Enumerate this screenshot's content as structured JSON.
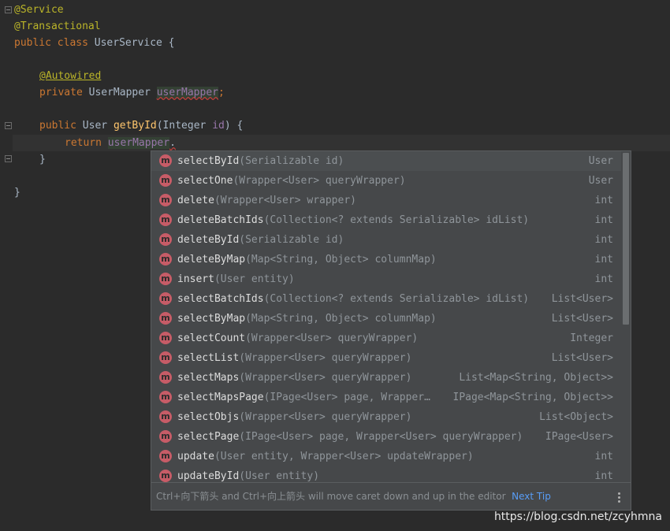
{
  "code": {
    "l1": "@Service",
    "l2": "@Transactional",
    "l3_kw1": "public ",
    "l3_kw2": "class ",
    "l3_name": "UserService {",
    "l5_ann": "@Autowired",
    "l6_kw": "private ",
    "l6_type": "UserMapper ",
    "l6_field": "userMapper",
    "l6_semi": ";",
    "l8_kw": "public ",
    "l8_type": "User ",
    "l8_method": "getById",
    "l8_paren": "(Integer ",
    "l8_param": "id",
    "l8_end": ") {",
    "l9_kw": "return ",
    "l9_field": "userMapper",
    "l9_dot": ".",
    "l10": "}",
    "l12": "}"
  },
  "completion": {
    "items": [
      {
        "name": "selectById",
        "sig": "(Serializable id)",
        "type": "User"
      },
      {
        "name": "selectOne",
        "sig": "(Wrapper<User> queryWrapper)",
        "type": "User"
      },
      {
        "name": "delete",
        "sig": "(Wrapper<User> wrapper)",
        "type": "int"
      },
      {
        "name": "deleteBatchIds",
        "sig": "(Collection<? extends Serializable> idList)",
        "type": "int"
      },
      {
        "name": "deleteById",
        "sig": "(Serializable id)",
        "type": "int"
      },
      {
        "name": "deleteByMap",
        "sig": "(Map<String, Object> columnMap)",
        "type": "int"
      },
      {
        "name": "insert",
        "sig": "(User entity)",
        "type": "int"
      },
      {
        "name": "selectBatchIds",
        "sig": "(Collection<? extends Serializable> idList)",
        "type": "List<User>"
      },
      {
        "name": "selectByMap",
        "sig": "(Map<String, Object> columnMap)",
        "type": "List<User>"
      },
      {
        "name": "selectCount",
        "sig": "(Wrapper<User> queryWrapper)",
        "type": "Integer"
      },
      {
        "name": "selectList",
        "sig": "(Wrapper<User> queryWrapper)",
        "type": "List<User>"
      },
      {
        "name": "selectMaps",
        "sig": "(Wrapper<User> queryWrapper)",
        "type": "List<Map<String, Object>>"
      },
      {
        "name": "selectMapsPage",
        "sig": "(IPage<User> page, Wrapper…",
        "type": "IPage<Map<String, Object>>"
      },
      {
        "name": "selectObjs",
        "sig": "(Wrapper<User> queryWrapper)",
        "type": "List<Object>"
      },
      {
        "name": "selectPage",
        "sig": "(IPage<User> page, Wrapper<User> queryWrapper)",
        "type": "IPage<User>"
      },
      {
        "name": "update",
        "sig": "(User entity, Wrapper<User> updateWrapper)",
        "type": "int"
      },
      {
        "name": "updateById",
        "sig": "(User entity)",
        "type": "int"
      }
    ],
    "icon_letter": "m",
    "icon": "method-icon",
    "footer_tip": "Ctrl+向下箭头 and Ctrl+向上箭头 will move caret down and up in the editor",
    "next_tip": "Next Tip",
    "more_icon": "more-vertical-icon"
  },
  "watermark": "https://blog.csdn.net/zcyhmna",
  "colors": {
    "background": "#2b2b2b",
    "keyword": "#cc7832",
    "annotation": "#bbb529",
    "method": "#ffc66d",
    "field": "#9876aa",
    "popup": "#46484a",
    "link": "#589df6"
  }
}
